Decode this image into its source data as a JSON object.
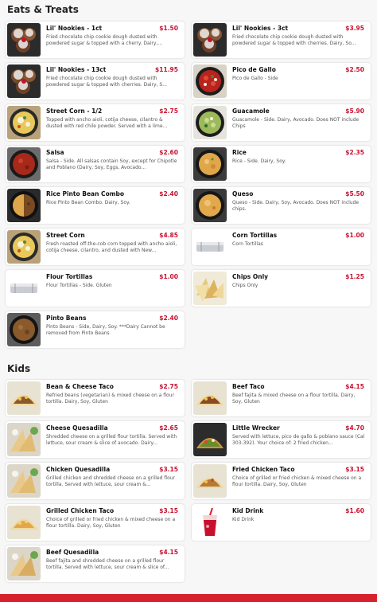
{
  "sections": [
    {
      "title": "Eats & Treats",
      "items": [
        {
          "name": "Lil' Nookies - 1ct",
          "price": "$1.50",
          "desc": "Fried chocolate chip cookie dough dusted with powdered sugar & topped with a cherry. Dairy,...",
          "icon": "cookie-dough-icon"
        },
        {
          "name": "Lil' Nookies - 3ct",
          "price": "$3.95",
          "desc": "Fried chocolate chip cookie dough dusted with powdered sugar & topped with cherries. Dairy, So...",
          "icon": "cookie-dough-icon"
        },
        {
          "name": "Lil' Nookies - 13ct",
          "price": "$11.95",
          "desc": "Fried chocolate chip cookie dough dusted with powdered sugar & topped with cherries. Dairy, S...",
          "icon": "cookie-dough-icon"
        },
        {
          "name": "Pico de Gallo",
          "price": "$2.50",
          "desc": "Pico de Gallo - Side",
          "icon": "pico-bowl-icon"
        },
        {
          "name": "Street Corn - 1/2",
          "price": "$2.75",
          "desc": "Topped with ancho aioli, cotija cheese, cilantro & dusted with red chile powder. Served with a lime...",
          "icon": "street-corn-bowl-icon"
        },
        {
          "name": "Guacamole",
          "price": "$5.90",
          "desc": "Guacamole - Side. Dairy, Avocado. Does NOT include Chips",
          "icon": "guacamole-bowl-icon"
        },
        {
          "name": "Salsa",
          "price": "$2.60",
          "desc": "Salsa - Side. All salsas contain Soy, except for Chipotle and Poblano (Dairy, Soy, Eggs, Avocado...",
          "icon": "salsa-bowl-icon"
        },
        {
          "name": "Rice",
          "price": "$2.35",
          "desc": "Rice - Side. Dairy, Soy.",
          "icon": "rice-bowl-icon"
        },
        {
          "name": "Rice Pinto Bean Combo",
          "price": "$2.40",
          "desc": "Rice Pinto Bean Combo. Dairy, Soy.",
          "icon": "rice-bean-bowl-icon"
        },
        {
          "name": "Queso",
          "price": "$5.50",
          "desc": "Queso - Side. Dairy, Soy, Avocado. Does NOT include chips.",
          "icon": "queso-bowl-icon"
        },
        {
          "name": "Street Corn",
          "price": "$4.85",
          "desc": "Fresh roasted off-the-cob corn topped with ancho aioli, cotija cheese, cilantro, and dusted with New...",
          "icon": "street-corn-bowl-icon"
        },
        {
          "name": "Corn Tortillas",
          "price": "$1.00",
          "desc": "Corn Tortillas",
          "icon": "tortilla-wrap-icon"
        },
        {
          "name": "Flour Tortillas",
          "price": "$1.00",
          "desc": "Flour Tortillas - Side. Gluten",
          "icon": "tortilla-wrap-icon"
        },
        {
          "name": "Chips Only",
          "price": "$1.25",
          "desc": "Chips Only",
          "icon": "chips-icon"
        },
        {
          "name": "Pinto Beans",
          "price": "$2.40",
          "desc": "Pinto Beans - Side, Dairy, Soy. ***Dairy Cannot be removed from Pinto Beans",
          "icon": "beans-bowl-icon"
        }
      ]
    },
    {
      "title": "Kids",
      "items": [
        {
          "name": "Bean & Cheese Taco",
          "price": "$2.75",
          "desc": "Refried beans (vegetarian) & mixed cheese on a flour tortilla. Dairy, Soy, Gluten",
          "icon": "taco-icon"
        },
        {
          "name": "Beef Taco",
          "price": "$4.15",
          "desc": "Beef fajita & mixed cheese on a flour tortilla. Dairy, Soy, Gluten",
          "icon": "taco-icon"
        },
        {
          "name": "Cheese Quesadilla",
          "price": "$2.65",
          "desc": "Shredded cheese on a grilled flour tortilla. Served with lettuce, sour cream & slice of avocado. Dairy...",
          "icon": "quesadilla-plate-icon"
        },
        {
          "name": "Little Wrecker",
          "price": "$4.70",
          "desc": "Served with lettuce, pico de gallo & poblano sauce (Cal 303-392). Your choice of: 2 fried chicken...",
          "icon": "taco-icon"
        },
        {
          "name": "Chicken Quesadilla",
          "price": "$3.15",
          "desc": "Grilled chicken and shredded cheese on a grilled flour tortilla. Served with lettuce, sour cream &...",
          "icon": "quesadilla-plate-icon"
        },
        {
          "name": "Fried Chicken Taco",
          "price": "$3.15",
          "desc": "Choice of grilled or fried chicken & mixed cheese on a flour tortilla. Dairy, Soy, Gluten",
          "icon": "taco-icon"
        },
        {
          "name": "Grilled Chicken Taco",
          "price": "$3.15",
          "desc": "Choice of grilled or fried chicken & mixed cheese on a flour tortilla. Dairy, Soy, Gluten",
          "icon": "taco-icon"
        },
        {
          "name": "Kid Drink",
          "price": "$1.60",
          "desc": "Kid Drink",
          "icon": "drink-cup-icon"
        },
        {
          "name": "Beef Quesadilla",
          "price": "$4.15",
          "desc": "Beef fajita and shredded cheese on a grilled flour tortilla. Served with lettuce, sour cream & slice of...",
          "icon": "quesadilla-plate-icon"
        }
      ]
    }
  ],
  "colors": {
    "price": "#c8102e",
    "bottom_bar": "#d6202e",
    "background": "#f7f7f7"
  }
}
